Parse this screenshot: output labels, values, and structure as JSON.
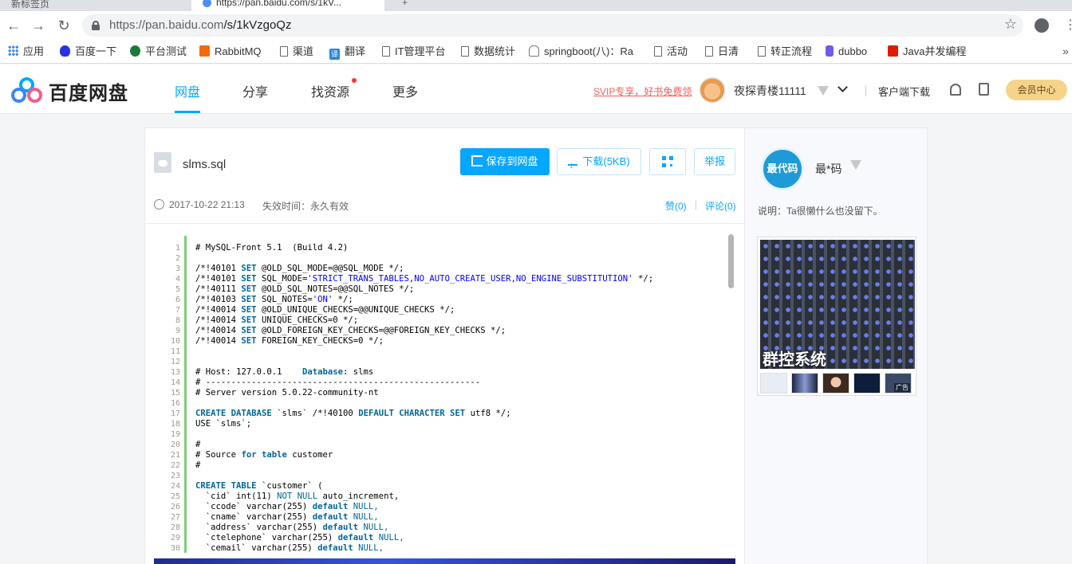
{
  "browser": {
    "tabs": [
      {
        "label": "新标签页"
      },
      {
        "label": "https://pan.baidu.com/s/1kV..."
      },
      {
        "label": "+"
      }
    ],
    "url_host": "https://pan.baidu.com",
    "url_path": "/s/1kVzgoQz"
  },
  "bookmarks": [
    {
      "label": "应用",
      "icon": "apps-grid-icon"
    },
    {
      "label": "百度一下",
      "icon": "baidu-paw-icon"
    },
    {
      "label": "平台测试",
      "icon": "platform-icon"
    },
    {
      "label": "RabbitMQ",
      "icon": "rabbitmq-icon"
    },
    {
      "label": "渠道",
      "icon": "page-icon"
    },
    {
      "label": "翻译",
      "icon": "translate-icon"
    },
    {
      "label": "IT管理平台",
      "icon": "page-icon"
    },
    {
      "label": "数据统计",
      "icon": "page-icon"
    },
    {
      "label": "springboot(八)：Ra",
      "icon": "database-icon"
    },
    {
      "label": "活动",
      "icon": "page-icon"
    },
    {
      "label": "日清",
      "icon": "page-icon"
    },
    {
      "label": "转正流程",
      "icon": "page-icon"
    },
    {
      "label": "dubbo",
      "icon": "dubbo-icon"
    },
    {
      "label": "Java并发编程",
      "icon": "java-icon"
    }
  ],
  "header": {
    "logo_text": "百度网盘",
    "nav": [
      "网盘",
      "分享",
      "找资源",
      "更多"
    ],
    "active_nav": "网盘",
    "svip_promo": "SVIP专享，好书免费领",
    "username": "夜探青楼11111",
    "client_download": "客户端下载",
    "vip_center": "会员中心"
  },
  "file": {
    "name": "slms.sql",
    "save_label": "保存到网盘",
    "download_label": "下载(5KB)",
    "report_label": "举报",
    "date": "2017-10-22 21:13",
    "expire": "失效时间：永久有效",
    "likes": "赞(0)",
    "comments": "评论(0)"
  },
  "code_lines": [
    "# MySQL-Front 5.1  (Build 4.2)",
    "",
    "/*!40101 SET @OLD_SQL_MODE=@@SQL_MODE */;",
    "/*!40101 SET SQL_MODE='STRICT_TRANS_TABLES,NO_AUTO_CREATE_USER,NO_ENGINE_SUBSTITUTION' */;",
    "/*!40111 SET @OLD_SQL_NOTES=@@SQL_NOTES */;",
    "/*!40103 SET SQL_NOTES='ON' */;",
    "/*!40014 SET @OLD_UNIQUE_CHECKS=@@UNIQUE_CHECKS */;",
    "/*!40014 SET UNIQUE_CHECKS=0 */;",
    "/*!40014 SET @OLD_FOREIGN_KEY_CHECKS=@@FOREIGN_KEY_CHECKS */;",
    "/*!40014 SET FOREIGN_KEY_CHECKS=0 */;",
    "",
    "",
    "# Host: 127.0.0.1    Database: slms",
    "# ------------------------------------------------------",
    "# Server version 5.0.22-community-nt",
    "",
    "CREATE DATABASE `slms` /*!40100 DEFAULT CHARACTER SET utf8 */;",
    "USE `slms`;",
    "",
    "#",
    "# Source for table customer",
    "#",
    "",
    "CREATE TABLE `customer` (",
    "  `cid` int(11) NOT NULL auto_increment,",
    "  `ccode` varchar(255) default NULL,",
    "  `cname` varchar(255) default NULL,",
    "  `address` varchar(255) default NULL,",
    "  `ctelephone` varchar(255) default NULL,",
    "  `cemail` varchar(255) default NULL,"
  ],
  "sharer": {
    "avatar_text": "最代码",
    "name": "最*码",
    "description": "说明：Ta很懒什么也没留下。"
  },
  "ad": {
    "caption": "群控系统",
    "label": "广告"
  }
}
